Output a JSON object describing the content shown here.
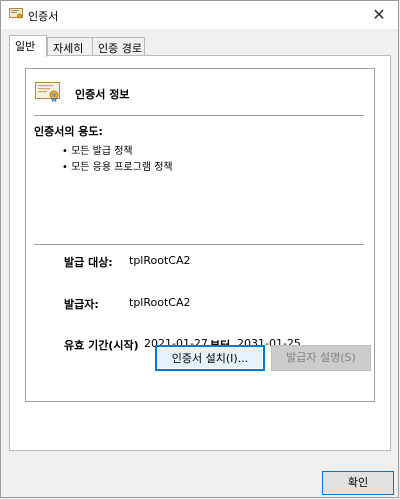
{
  "window": {
    "title": "인증서"
  },
  "tabs": [
    {
      "label": "일반"
    },
    {
      "label": "자세히"
    },
    {
      "label": "인증 경로"
    }
  ],
  "info": {
    "heading": "인증서 정보",
    "purpose_label": "인증서의 용도:",
    "purposes": [
      "• 모든 발급 정책",
      "• 모든 응용 프로그램 정책"
    ]
  },
  "fields": {
    "issued_to_label": "발급 대상:",
    "issued_to_value": "tplRootCA2",
    "issued_by_label": "발급자:",
    "issued_by_value": "tplRootCA2",
    "validity_label": "유효 기간(시작)",
    "valid_from": "2021-01-27",
    "validity_to_label": "부터",
    "valid_to": "2031-01-25"
  },
  "buttons": {
    "install": "인증서 설치(I)...",
    "issuer_statement": "발급자 설명(S)",
    "ok": "확인"
  },
  "icons": {
    "title": "certificate-icon",
    "close": "close-icon",
    "cert_info": "certificate-icon"
  }
}
